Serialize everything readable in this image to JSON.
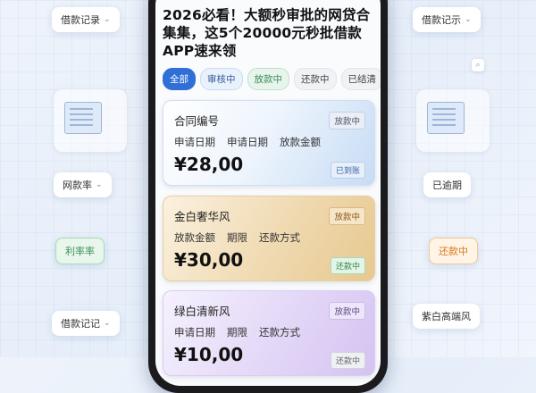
{
  "title": "2026必看！大额秒审批的网贷合集集，这5个20000元秒批借款APP速来领",
  "tabs": [
    "全部",
    "审核中",
    "放款中",
    "还款中",
    "已结清"
  ],
  "cards": [
    {
      "title": "合同编号",
      "badge": "放款中",
      "labels": [
        "申请日期",
        "申请日期",
        "放款金额"
      ],
      "amount": "¥28,00",
      "status": "已到账"
    },
    {
      "title": "金白奢华风",
      "badge": "放款中",
      "labels": [
        "放款金额",
        "期限",
        "还款方式"
      ],
      "amount": "¥30,00",
      "status": "还款中"
    },
    {
      "title": "绿白清新风",
      "badge": "放款中",
      "labels": [
        "申请日期",
        "期限",
        "还款方式"
      ],
      "amount": "¥10,00",
      "status": "还款中"
    }
  ],
  "floating": {
    "top_left": "借款记录",
    "top_right": "借款记示",
    "mid_left": "网款率",
    "mid_right": "已逾期",
    "rate": "利率率",
    "repaying": "还款中",
    "bottom_left": "借款记记",
    "bottom_right": "紫白高端风"
  },
  "colors": {
    "accent": "#2f6fd6",
    "green": "#3f8f5a",
    "orange": "#d67a20"
  }
}
